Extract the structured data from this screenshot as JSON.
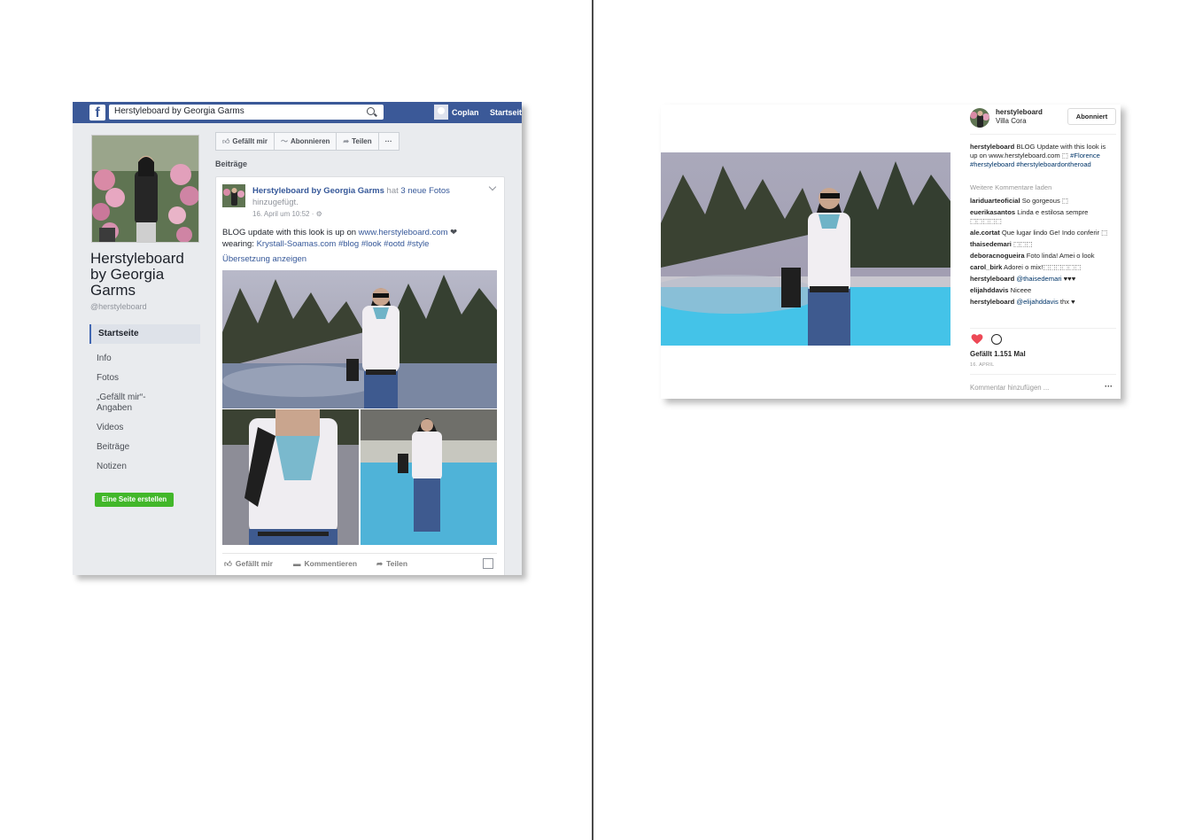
{
  "facebook": {
    "search": {
      "value": "Herstyleboard by Georgia Garms"
    },
    "header": {
      "user": "Coplan",
      "home": "Startseite"
    },
    "page": {
      "name": "Herstyleboard by Georgia Garms",
      "handle": "@herstyleboard"
    },
    "nav": {
      "items": [
        "Startseite",
        "Info",
        "Fotos",
        "„Gefällt mir“-Angaben",
        "Videos",
        "Beiträge",
        "Notizen"
      ],
      "active": "Startseite"
    },
    "create_page_label": "Eine Seite erstellen",
    "action_bar": {
      "like": "Gefällt mir",
      "follow": "Abonnieren",
      "share": "Teilen",
      "more": "···"
    },
    "section_title": "Beiträge",
    "post": {
      "author": "Herstyleboard by Georgia Garms",
      "action_pre": "hat",
      "action_link": "3 neue Fotos",
      "action_post": "hinzugefügt.",
      "date": "16. April um 10:52 · ⚙",
      "body_pre": "BLOG update with this look is up on",
      "body_link": "www.herstyleboard.com",
      "body_heart": "❤",
      "body_line2_pre": "wearing:",
      "body_line2_tags": "Krystall-Soamas.com #blog #look #ootd #style",
      "translate": "Übersetzung anzeigen",
      "bar": {
        "like": "Gefällt mir",
        "comment": "Kommentieren",
        "share": "Teilen"
      }
    }
  },
  "instagram": {
    "user": "herstyleboard",
    "location": "Villa Cora",
    "follow_label": "Abonniert",
    "caption": {
      "user": "herstyleboard",
      "text": "BLOG Update with this look is up on www.herstyleboard.com ⬚",
      "tags": "#Florence #herstyleboard #herstyleboardontheroad"
    },
    "more_comments": "Weitere Kommentare laden",
    "comments": [
      {
        "user": "lariduarteoficial",
        "text": "So gorgeous ⬚"
      },
      {
        "user": "euerikasantos",
        "text": "Linda e estilosa sempre ⬚⬚⬚⬚⬚"
      },
      {
        "user": "ale.cortat",
        "text": "Que lugar lindo Ge! Indo conferir ⬚"
      },
      {
        "user": "thaisedemari",
        "text": "⬚⬚⬚"
      },
      {
        "user": "deboracnogueira",
        "text": "Foto linda! Amei o look"
      },
      {
        "user": "carol_birk",
        "text": "Adorei o mix!⬚⬚⬚⬚⬚⬚"
      },
      {
        "user": "herstyleboard",
        "mention": "@thaisedemari",
        "text": "♥♥♥"
      },
      {
        "user": "elijahddavis",
        "text": "Niceee"
      },
      {
        "user": "herstyleboard",
        "mention": "@elijahddavis",
        "text": "thx ♥"
      }
    ],
    "likes": "Gefällt 1.151 Mal",
    "date": "16. APRIL",
    "add_comment_placeholder": "Kommentar hinzufügen ...",
    "more_options": "···",
    "heart_color": "#ed4956"
  },
  "colors": {
    "fb_blue": "#3b5998",
    "fb_link": "#365899",
    "fb_green": "#42b72a",
    "divider": "#4a4a4a"
  }
}
